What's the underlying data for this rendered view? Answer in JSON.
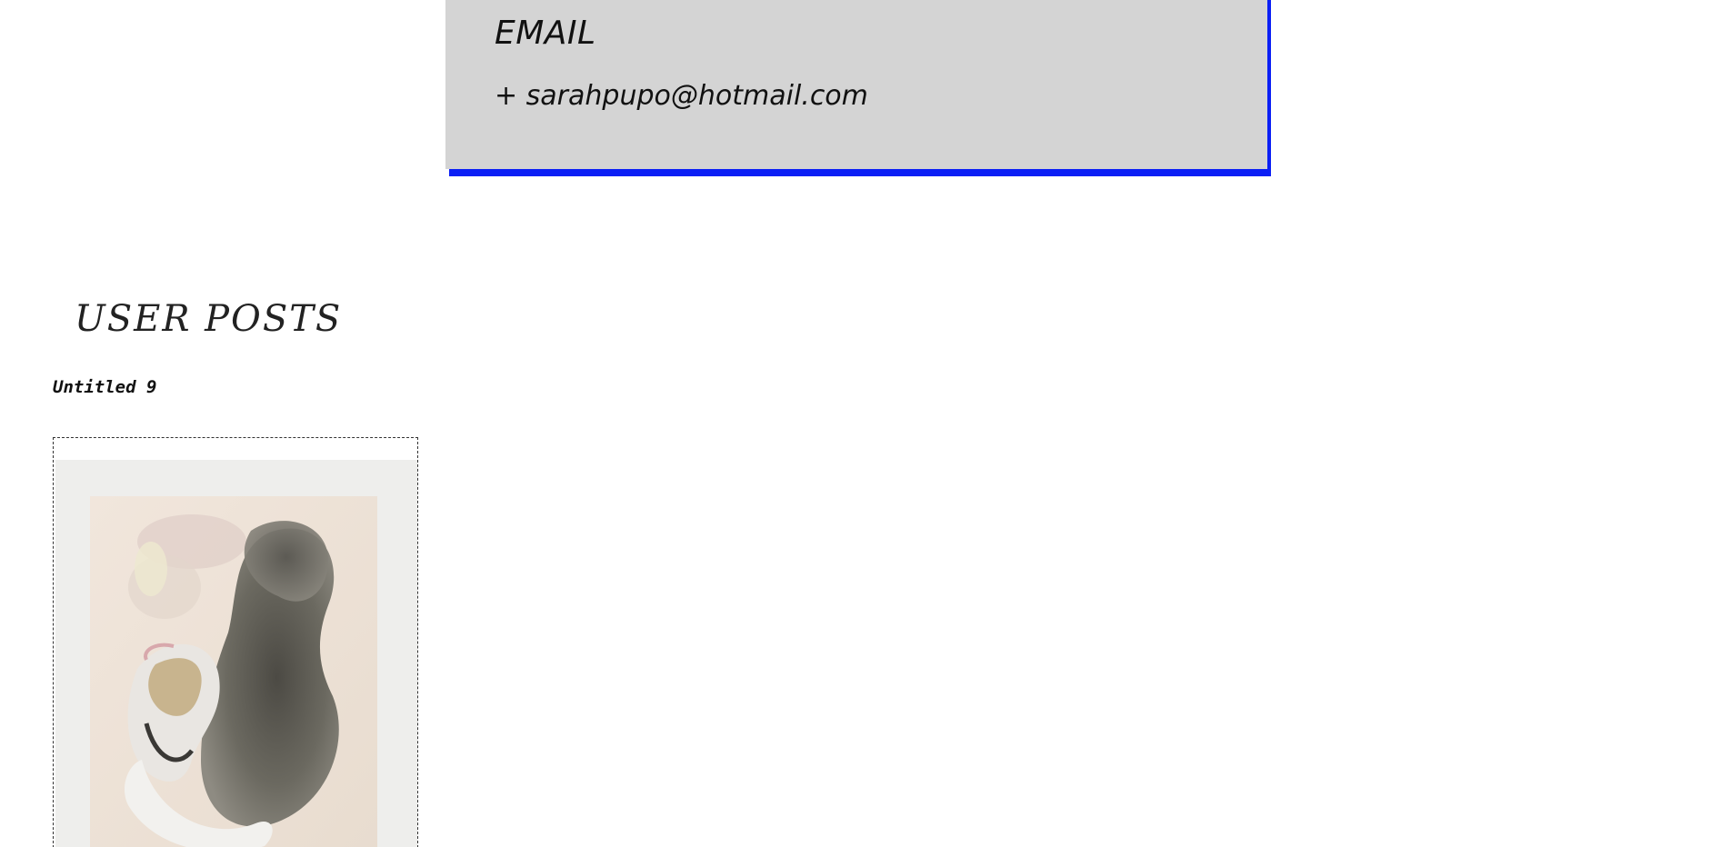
{
  "contact": {
    "heading": "EMAIL",
    "email": "+ sarahpupo@hotmail.com",
    "accent_color": "#0b1ff5",
    "card_color": "#d4d4d4"
  },
  "user_posts": {
    "section_title": "USER POSTS",
    "posts": [
      {
        "title": "Untitled 9",
        "image_icon": "abstract-painting-thumbnail"
      }
    ]
  }
}
